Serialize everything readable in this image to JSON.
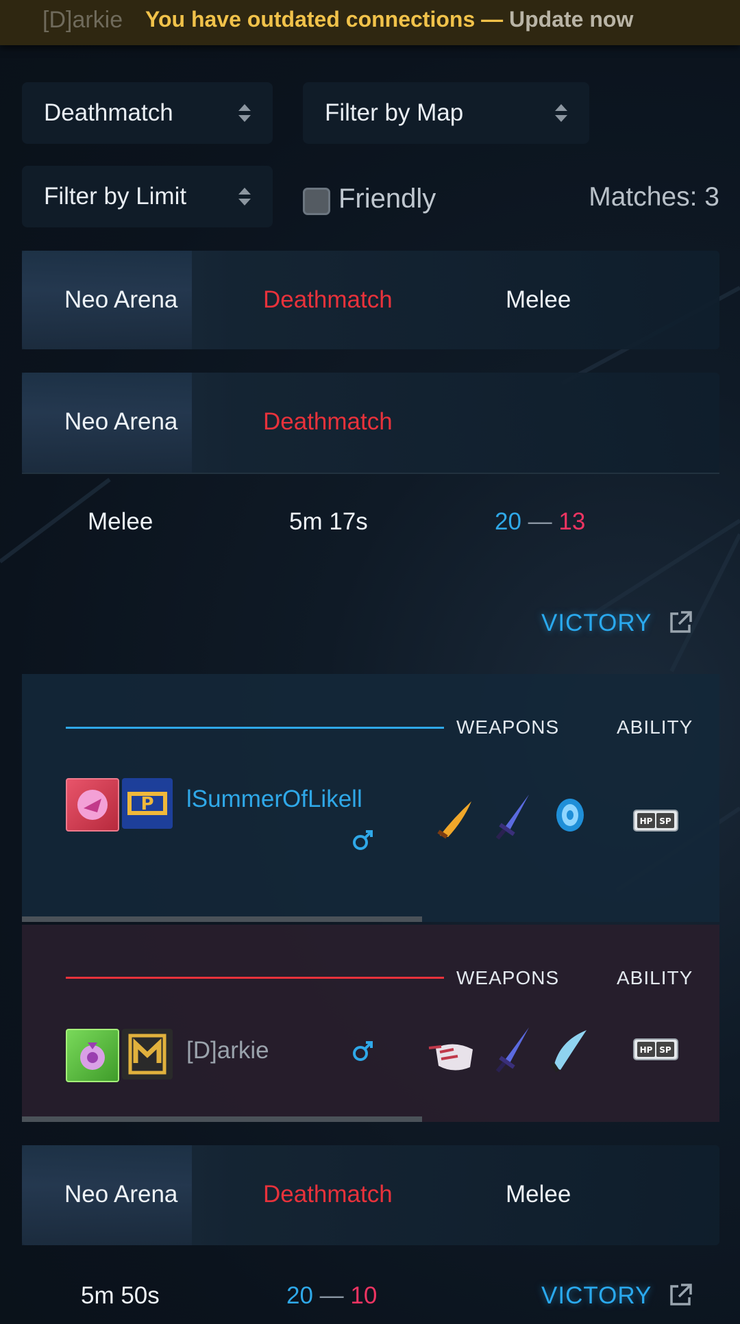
{
  "banner": {
    "ghost_name": "[D]arkie",
    "message": "You have outdated connections —",
    "link": "Update now"
  },
  "filters": {
    "mode": "Deathmatch",
    "map": "Filter by Map",
    "limit": "Filter by Limit",
    "friendly_label": "Friendly",
    "matches": "Matches: 3"
  },
  "matches": [
    {
      "map": "Neo Arena",
      "mode": "Deathmatch",
      "limit": "Melee"
    },
    {
      "map": "Neo Arena",
      "mode": "Deathmatch",
      "limit": "Melee",
      "duration": "5m 17s",
      "score_blue": "20",
      "score_sep": "—",
      "score_red": "13",
      "result": "VICTORY",
      "teams": {
        "weapons_label": "WEAPONS",
        "ability_label": "ABILITY",
        "blue_player": "lSummerOfLikell",
        "red_player": "[D]arkie",
        "blue_icon": "mars-icon",
        "red_icon": "mars-icon"
      }
    },
    {
      "map": "Neo Arena",
      "mode": "Deathmatch",
      "limit": "Melee",
      "duration": "5m 50s",
      "score_blue": "20",
      "score_sep": "—",
      "score_red": "10",
      "result": "VICTORY"
    }
  ],
  "ability_badge": {
    "left": "HP",
    "right": "SP"
  },
  "colors": {
    "accent_blue": "#2fa8e8",
    "accent_red": "#e8323b",
    "score_red": "#ee3462",
    "banner_text": "#f1c24a"
  }
}
